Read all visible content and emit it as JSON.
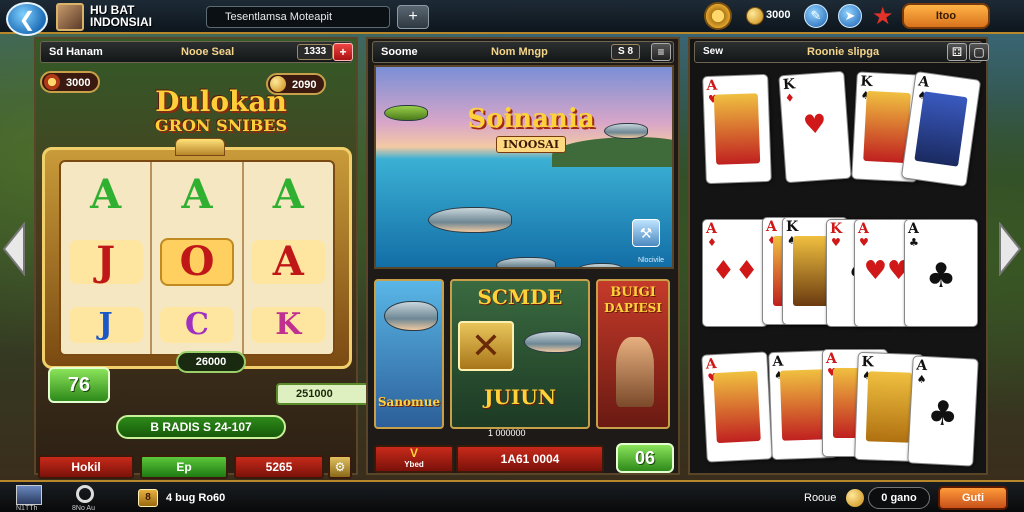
{
  "topbar": {
    "title_line1": "HU BAT",
    "title_line2": "INDONSIAI",
    "search_text": "Tesentlamsa Moteapit",
    "add_label": "+",
    "coin_amount": "3000",
    "topup_label": "Itoo"
  },
  "slots": {
    "header_left": "Sd Hanam",
    "header_center": "Nooe Seal",
    "header_badge": "1333",
    "header_btn": "+",
    "chip_left": "3000",
    "chip_right": "2090",
    "logo_line1": "Dulokan",
    "logo_line2": "GRON SNIBES",
    "reels": [
      {
        "top": "A",
        "mid": "J",
        "bot": "J"
      },
      {
        "top": "A",
        "mid": "O",
        "bot": "C"
      },
      {
        "top": "A",
        "mid": "A",
        "bot": "K"
      }
    ],
    "bet_value": "26000",
    "score_box": "76",
    "win_value": "251000",
    "info_bar": "B RADIS S 24-107",
    "btn_left": "Hokil",
    "btn_mid": "Ep",
    "btn_right": "5265"
  },
  "fishing": {
    "header_left": "Soome",
    "header_center": "Nom Mngp",
    "header_badge": "S 8",
    "logo_line1": "Soinania",
    "logo_line2": "INOOSAI",
    "scene_label": "Nlocivile",
    "tile_mid_title": "SCMDE",
    "tile_blue_title": "Sanomue",
    "tile_mid_bottom": "JUIUN",
    "tile_mid_sub": "1 000000",
    "tile_red_title1": "BUIGI",
    "tile_red_title2": "DAPIESI",
    "foot_left": "V",
    "foot_left_sub": "Ybed",
    "foot_mid": "1A61 0004",
    "foot_right": "06"
  },
  "cards": {
    "header_left": "Sew",
    "header_center": "Roonie slipga",
    "header_btn1": "⚃",
    "header_btn2": "▢"
  },
  "bottombar": {
    "icon1_label": "N1TTh",
    "icon2_label": "8No Au",
    "stake_label": "4  bug Ro60",
    "stake_icon": "8",
    "right_label": "Rooue",
    "zero_label": "0 gano",
    "cashout_label": "Guti"
  },
  "colors": {
    "gold": "#f1cf6a",
    "accent_orange": "#d9731c",
    "green": "#2e8a1a",
    "red": "#c11a1a"
  }
}
